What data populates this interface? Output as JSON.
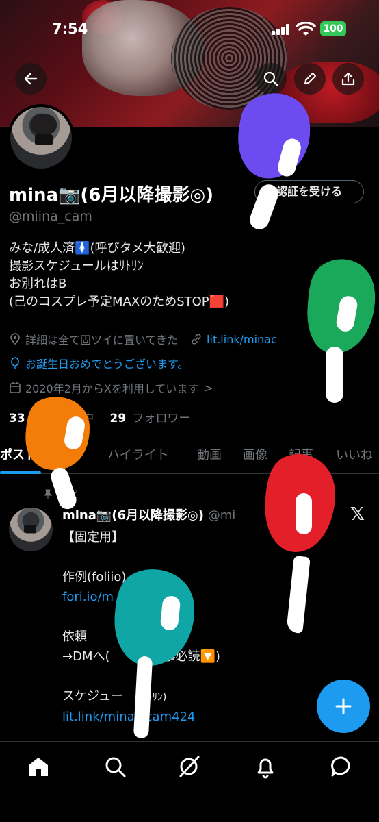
{
  "status": {
    "time": "7:54",
    "battery": "100"
  },
  "profile": {
    "name": "mina📷(6月以降撮影◎)",
    "handle": "@miina_cam",
    "verify_label": "認証を受ける",
    "bio": [
      "みな/成人済🚺(呼びタメ大歓迎)",
      "撮影スケジュールはﾘﾄﾘﾝ",
      "お別れはB",
      "(己のコスプレ予定MAXのためSTOP🟥)"
    ],
    "location": "詳細は全て固ツイに置いてきた",
    "link": "lit.link/minac",
    "birthday": "お誕生日おめでとうございます。",
    "joined": "2020年2月からXを利用しています",
    "joined_chevron": ">",
    "following_count": "33",
    "following_label": "中",
    "followers_count": "29",
    "followers_label": "フォロワー"
  },
  "tabs": [
    "ポスト",
    "ハイライト",
    "動画",
    "画像",
    "記事",
    "いいね"
  ],
  "post": {
    "pinned_label": "固定",
    "author": "mina📷(6月以降撮影◎)",
    "author_handle": "@mi",
    "lines": [
      "【固定用】",
      "",
      "作例(foliio)",
      "fori.io/m",
      "",
      "依頼",
      "→DMへ(",
      "記事必読🔽)",
      "",
      "スケジュー",
      "(ﾘﾄﾘﾝ)",
      "lit.link/mina",
      "cam424"
    ],
    "x_mark": "𝕏"
  },
  "colors": {
    "accent": "#1d9bf0",
    "background": "#000000",
    "muted": "#71767b",
    "verified_battery": "#34c759"
  },
  "icons": [
    "back-arrow-icon",
    "search-icon",
    "pencil-icon",
    "share-icon",
    "location-icon",
    "link-icon",
    "balloon-icon",
    "calendar-icon",
    "pin-icon",
    "plus-icon",
    "home-icon",
    "explore-icon",
    "grok-icon",
    "notifications-icon",
    "messages-icon"
  ]
}
